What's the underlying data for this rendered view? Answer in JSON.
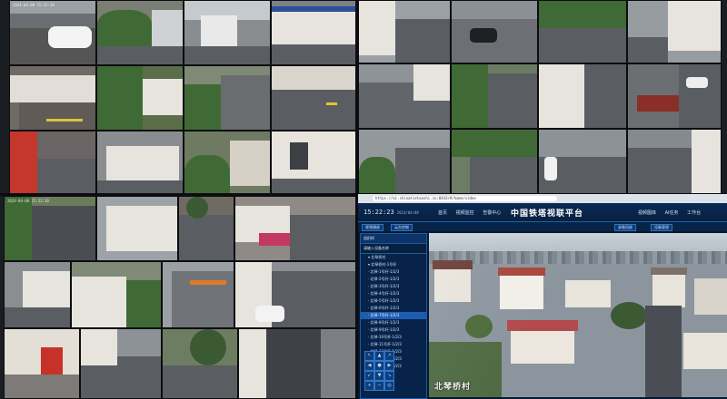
{
  "platform": {
    "url": "https://ai.chinatietaoshi.cn:8443/#/home/video",
    "clock": "15:22:23",
    "clock_sub": "2024/04/08",
    "title": "中国铁塔视联平台",
    "nav_left": [
      "首页",
      "视频监控",
      "告警中心"
    ],
    "nav_right": [
      "视频图库",
      "AI任务",
      "工作台"
    ],
    "subtabs": [
      "视频播放",
      "云台控制",
      "录像回放",
      "设备管理"
    ],
    "sidebar": {
      "header": "组织树",
      "search": "请输入设备名称",
      "items": [
        {
          "label": "▾ 北琴桥村",
          "selected": false
        },
        {
          "label": "▾ 北琴桥村-1号杆",
          "selected": false
        },
        {
          "label": "· 北琴-1号杆-1/2/3",
          "selected": false
        },
        {
          "label": "· 北琴-2号杆-1/2/3",
          "selected": false
        },
        {
          "label": "· 北琴-3号杆-1/2/3",
          "selected": false
        },
        {
          "label": "· 北琴-4号杆-1/2/3",
          "selected": false
        },
        {
          "label": "· 北琴-5号杆-1/2/3",
          "selected": false
        },
        {
          "label": "· 北琴-6号杆-1/2/3",
          "selected": false
        },
        {
          "label": "· 北琴-7号杆-1/2/3",
          "selected": true
        },
        {
          "label": "· 北琴-8号杆-1/2/3",
          "selected": false
        },
        {
          "label": "· 北琴-9号杆-1/2/3",
          "selected": false
        },
        {
          "label": "· 北琴-10号杆-1/2/3",
          "selected": false
        },
        {
          "label": "· 北琴-11号杆-1/2/3",
          "selected": false
        },
        {
          "label": "· 北琴-12号杆-1/2/3",
          "selected": false
        },
        {
          "label": "· 北琴-13号杆-1/2/3",
          "selected": false
        },
        {
          "label": "· 北琴-14号杆-1/2/3",
          "selected": false
        }
      ]
    },
    "video_label": "北琴桥村"
  },
  "cameras": [
    {
      "stamp": "2024-04-08 15:22:20"
    },
    {
      "stamp": "2024-04-08 15:22:20"
    }
  ],
  "colors": {
    "platform_bg": "#06182f",
    "accent": "#1c5db0"
  }
}
